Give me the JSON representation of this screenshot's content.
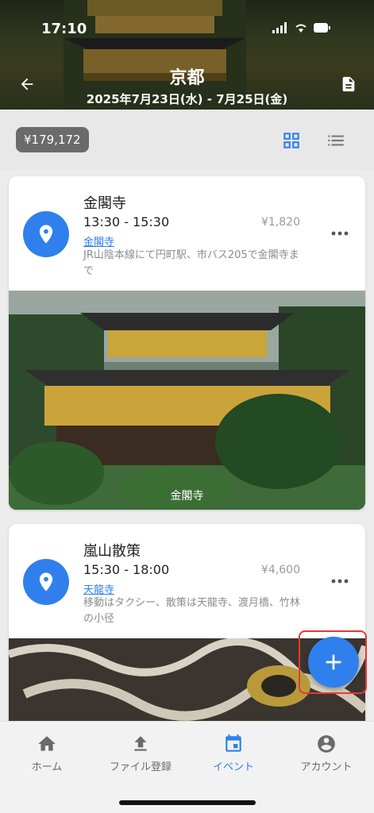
{
  "status_bar": {
    "time": "17:10"
  },
  "header": {
    "title": "京都",
    "date_range": "2025年7月23日(水) - 7月25日(金)"
  },
  "toolbar": {
    "total_cost": "¥179,172",
    "views": [
      "grid-view-icon",
      "list-view-icon"
    ],
    "active_view": "grid"
  },
  "events": [
    {
      "title": "金閣寺",
      "time": "13:30 - 15:30",
      "cost": "¥1,820",
      "location_link": "金閣寺",
      "note": "JR山陰本線にて円町駅、市バス205で金閣寺まで",
      "photo_caption": "金閣寺"
    },
    {
      "title": "嵐山散策",
      "time": "15:30 - 18:00",
      "cost": "¥4,600",
      "location_link": "天龍寺",
      "note": "移動はタクシー、散策は天龍寺、渡月橋、竹林の小径"
    }
  ],
  "bottom_nav": {
    "items": [
      {
        "label": "ホーム",
        "icon": "home-icon"
      },
      {
        "label": "ファイル登録",
        "icon": "upload-icon"
      },
      {
        "label": "イベント",
        "icon": "calendar-icon"
      },
      {
        "label": "アカウント",
        "icon": "account-icon"
      }
    ],
    "active": "イベント"
  },
  "colors": {
    "accent": "#2f80ed",
    "highlight": "#e53935"
  }
}
